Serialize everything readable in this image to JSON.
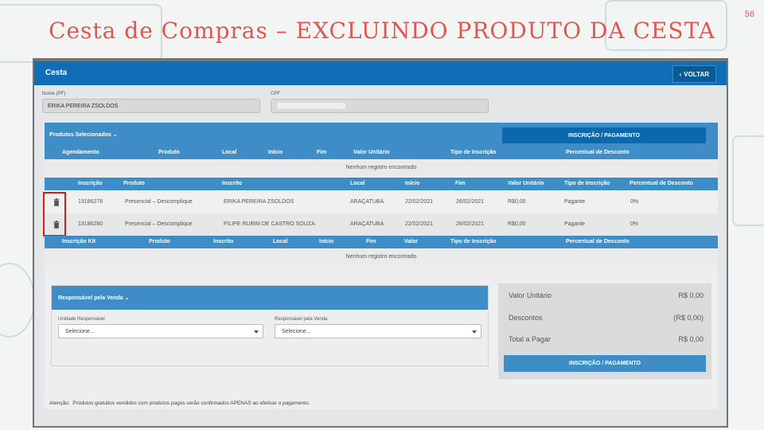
{
  "slide": {
    "title": "Cesta de Compras – EXCLUINDO PRODUTO DA CESTA",
    "number": "56",
    "title_color": "#e0574f"
  },
  "header": {
    "title": "Cesta",
    "back_label": "VOLTAR",
    "back_icon": "chevron-left-icon",
    "color": "#0f6eb5"
  },
  "customer": {
    "name_label": "Nome (PF)",
    "name_value": "ERIKA PEREIRA ZSOLDOS",
    "cpf_label": "CPF",
    "cpf_value": ""
  },
  "products_section": {
    "label": "Produtos Selecionados",
    "pay_button": "INSCRIÇÃO / PAGAMENTO",
    "table1_headers": [
      "Agendamento",
      "Produto",
      "Local",
      "Início",
      "Fim",
      "Valor Unitário",
      "Tipo de Inscrição",
      "Percentual de Desconto"
    ],
    "table1_empty": "Nenhum registro encontrado",
    "table2_headers": [
      "Inscrição",
      "Produto",
      "Inscrito",
      "Local",
      "Início",
      "Fim",
      "Valor Unitário",
      "Tipo de Inscrição",
      "Percentual de Desconto"
    ],
    "rows": [
      {
        "inscricao": "13186278",
        "produto": "Presencial – Descomplique",
        "inscrito": "ERIKA PEREIRA ZSOLDOS",
        "local": "ARAÇATUBA",
        "inicio": "22/02/2021",
        "fim": "26/02/2021",
        "valor": "R$0,00",
        "tipo": "Pagante",
        "desconto": "0%"
      },
      {
        "inscricao": "13186280",
        "produto": "Presencial – Descomplique",
        "inscrito": "FILIPE RUBIM DE CASTRO SOUZA",
        "local": "ARAÇATUBA",
        "inicio": "22/02/2021",
        "fim": "26/02/2021",
        "valor": "R$0,00",
        "tipo": "Pagante",
        "desconto": "0%"
      }
    ],
    "table3_headers": [
      "Inscrição Kit",
      "Produto",
      "Inscrito",
      "Local",
      "Início",
      "Fim",
      "Valor",
      "Tipo de Inscrição",
      "Percentual de Desconto"
    ],
    "table3_empty": "Nenhum registro encontrado"
  },
  "responsavel": {
    "label": "Responsável pela Venda",
    "unidade_label": "Unidade Responsável",
    "unidade_value": "Selecione...",
    "resp_label": "Responsável pela Venda",
    "resp_value": "Selecione..."
  },
  "summary": {
    "unit_label": "Valor Unitário",
    "unit_value": "R$ 0,00",
    "disc_label": "Descontos",
    "disc_value": "(R$ 0,00)",
    "total_label": "Total a Pagar",
    "total_value": "R$ 0,00",
    "pay_button": "INSCRIÇÃO / PAGAMENTO"
  },
  "note": {
    "prefix": "Atenção:",
    "text": "Produtos gratuitos vendidos com produtos pagos serão confirmados APENAS ao efetivar o pagamento."
  }
}
